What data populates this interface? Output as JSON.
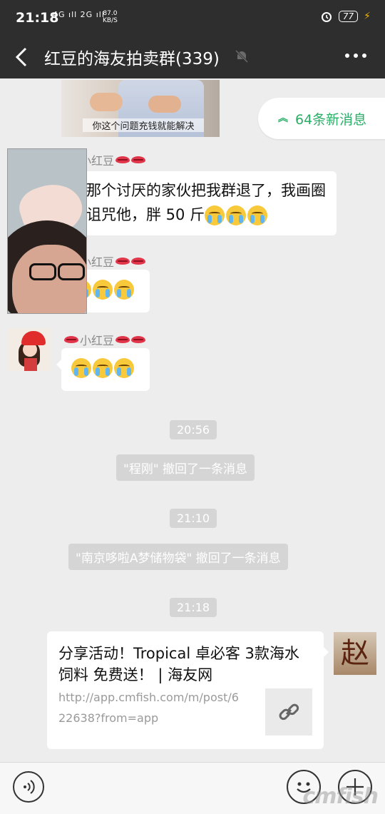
{
  "status_bar": {
    "time": "21:18",
    "network": "4G ıll 2G ıll",
    "speed_value": "87.0",
    "speed_unit": "KB/S",
    "battery": "77"
  },
  "header": {
    "title": "红豆的海友拍卖群(339)"
  },
  "new_messages": "64条新消息",
  "video_caption": "你这个问题充钱就能解决",
  "messages": [
    {
      "sender": "小红豆",
      "text": "又那个讨厌的家伙把我群退了，我画圈圈诅咒他，胖 50 斤"
    },
    {
      "sender": "小红豆"
    },
    {
      "sender": "小红豆"
    }
  ],
  "system": [
    {
      "time": "20:56",
      "text": "\"程刚\" 撤回了一条消息"
    },
    {
      "time": "21:10",
      "text": "\"南京哆啦A梦储物袋\" 撤回了一条消息"
    },
    {
      "time": "21:18"
    }
  ],
  "link_card": {
    "title": "分享活动！Tropical 卓必客 3款海水饲料 免费送！ | 海友网",
    "url": "http://app.cmfish.com/m/post/622638?from=app"
  },
  "avatar_zhao": "赵",
  "watermark": "cmfish",
  "icons": [
    "back-arrow-icon",
    "mute-bell-icon",
    "more-dots-icon",
    "chevron-up-icon",
    "link-icon",
    "voice-icon",
    "emoji-icon",
    "plus-icon",
    "wifi-icon",
    "alarm-icon"
  ],
  "colors": {
    "bar": "#2e2e2e",
    "background": "#ededed",
    "accent_green": "#2aae67"
  }
}
